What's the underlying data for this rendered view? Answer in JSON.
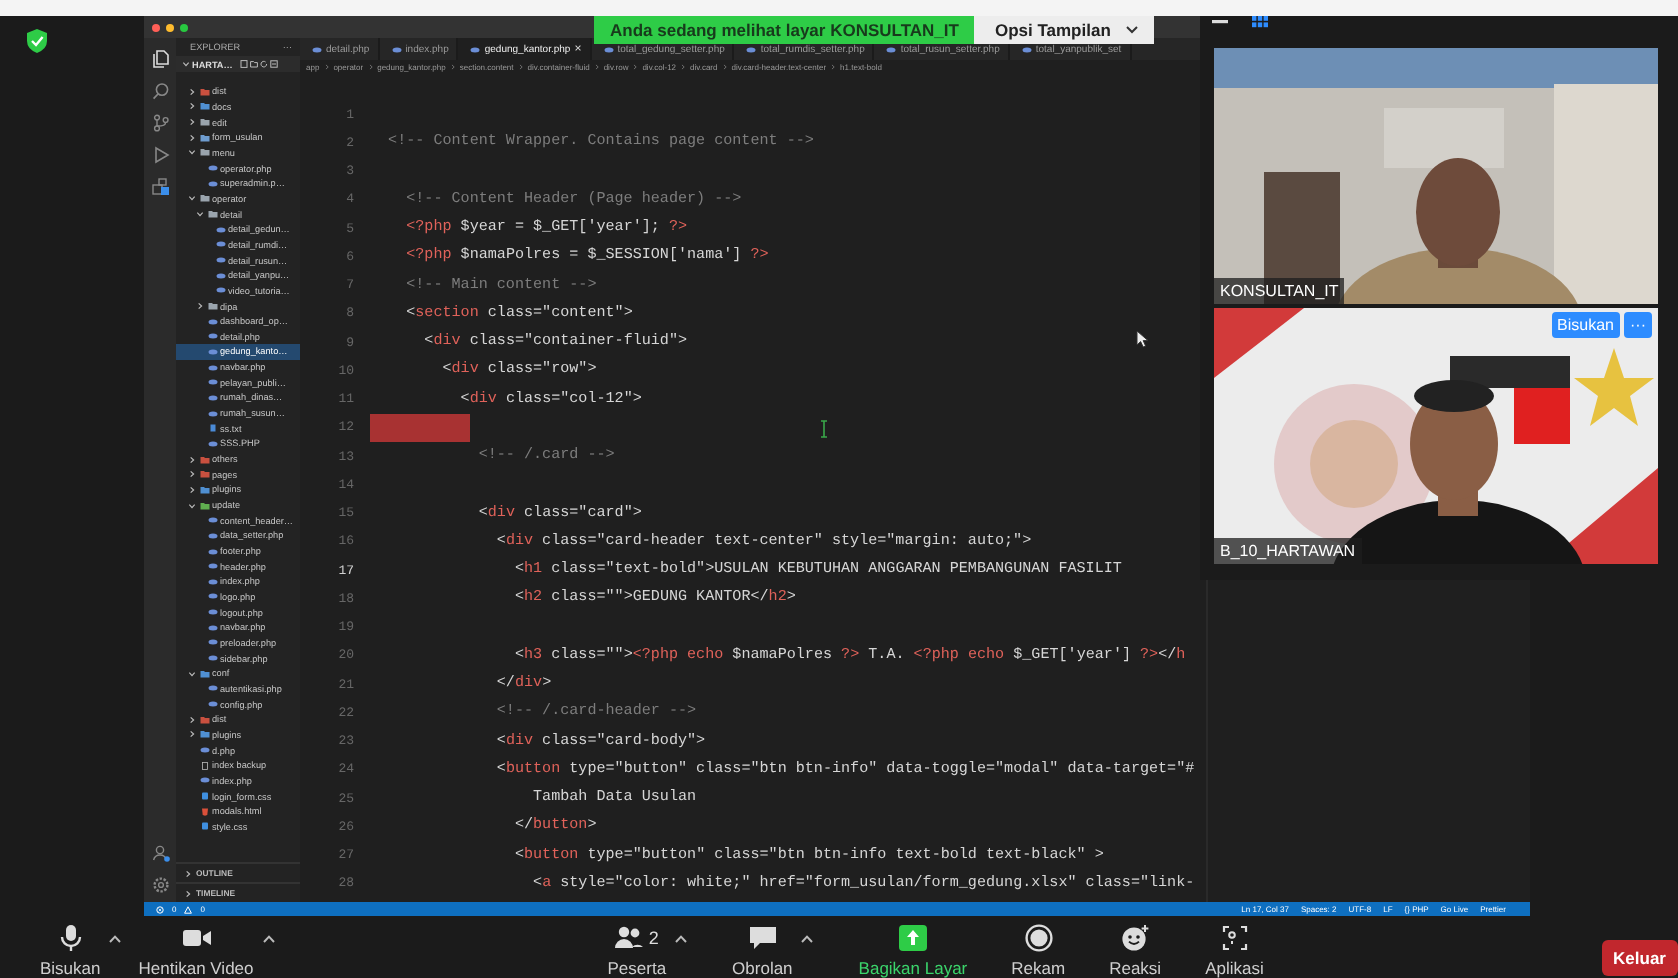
{
  "banner": {
    "text": "Anda sedang melihat layar KONSULTAN_IT",
    "options": "Opsi Tampilan"
  },
  "editor": {
    "explorer": {
      "title": "EXPLORER",
      "more": "···",
      "root": "HARTA…",
      "tree": [
        {
          "name": "dist",
          "kind": "folder",
          "color": "#c9503f",
          "expanded": false,
          "selected": false
        },
        {
          "name": "docs",
          "kind": "folder",
          "color": "#4f8fd1",
          "expanded": false,
          "selected": false
        },
        {
          "name": "edit",
          "kind": "folder",
          "color": "#9aa4ad",
          "expanded": false,
          "selected": false
        },
        {
          "name": "form_usulan",
          "kind": "folder",
          "color": "#6e9ccf",
          "expanded": false,
          "selected": false
        },
        {
          "name": "menu",
          "kind": "folder",
          "color": "#9aa4ad",
          "expanded": true,
          "selected": false,
          "children": [
            {
              "name": "operator.php",
              "kind": "php",
              "selected": false
            },
            {
              "name": "superadmin.p…",
              "kind": "php",
              "selected": false
            }
          ]
        },
        {
          "name": "operator",
          "kind": "folder",
          "color": "#9aa4ad",
          "expanded": true,
          "selected": false,
          "children": [
            {
              "name": "detail",
              "kind": "folder",
              "color": "#9aa4ad",
              "expanded": true,
              "selected": false,
              "children": [
                {
                  "name": "detail_gedun…",
                  "kind": "php",
                  "selected": false
                },
                {
                  "name": "detail_rumdi…",
                  "kind": "php",
                  "selected": false
                },
                {
                  "name": "detail_rusun…",
                  "kind": "php",
                  "selected": false
                },
                {
                  "name": "detail_yanpu…",
                  "kind": "php",
                  "selected": false
                },
                {
                  "name": "video_tutoria…",
                  "kind": "php",
                  "selected": false
                }
              ]
            },
            {
              "name": "dipa",
              "kind": "folder",
              "color": "#9aa4ad",
              "expanded": false,
              "selected": false
            },
            {
              "name": "dashboard_op…",
              "kind": "php",
              "selected": false
            },
            {
              "name": "detail.php",
              "kind": "php",
              "selected": false
            },
            {
              "name": "gedung_kanto…",
              "kind": "php",
              "selected": true
            },
            {
              "name": "navbar.php",
              "kind": "php",
              "selected": false
            },
            {
              "name": "pelayan_publi…",
              "kind": "php",
              "selected": false
            },
            {
              "name": "rumah_dinas…",
              "kind": "php",
              "selected": false
            },
            {
              "name": "rumah_susun…",
              "kind": "php",
              "selected": false
            },
            {
              "name": "ss.txt",
              "kind": "txt",
              "selected": false
            },
            {
              "name": "SSS.PHP",
              "kind": "php",
              "selected": false
            }
          ]
        },
        {
          "name": "others",
          "kind": "folder",
          "color": "#c9503f",
          "expanded": false,
          "selected": false
        },
        {
          "name": "pages",
          "kind": "folder",
          "color": "#c9503f",
          "expanded": false,
          "selected": false
        },
        {
          "name": "plugins",
          "kind": "folder",
          "color": "#4f8fd1",
          "expanded": false,
          "selected": false
        },
        {
          "name": "update",
          "kind": "folder",
          "color": "#5fae4f",
          "expanded": true,
          "selected": false,
          "children": [
            {
              "name": "content_header…",
              "kind": "php",
              "selected": false
            },
            {
              "name": "data_setter.php",
              "kind": "php",
              "selected": false
            },
            {
              "name": "footer.php",
              "kind": "php",
              "selected": false
            },
            {
              "name": "header.php",
              "kind": "php",
              "selected": false
            },
            {
              "name": "index.php",
              "kind": "php",
              "selected": false
            },
            {
              "name": "logo.php",
              "kind": "php",
              "selected": false
            },
            {
              "name": "logout.php",
              "kind": "php",
              "selected": false
            },
            {
              "name": "navbar.php",
              "kind": "php",
              "selected": false
            },
            {
              "name": "preloader.php",
              "kind": "php",
              "selected": false
            },
            {
              "name": "sidebar.php",
              "kind": "php",
              "selected": false
            }
          ]
        },
        {
          "name": "conf",
          "kind": "folder",
          "color": "#4f8fd1",
          "expanded": true,
          "selected": false,
          "children": [
            {
              "name": "autentikasi.php",
              "kind": "php",
              "selected": false
            },
            {
              "name": "config.php",
              "kind": "php",
              "selected": false
            }
          ]
        },
        {
          "name": "dist",
          "kind": "folder",
          "color": "#c9503f",
          "expanded": false,
          "selected": false
        },
        {
          "name": "plugins",
          "kind": "folder",
          "color": "#4f8fd1",
          "expanded": false,
          "selected": false
        },
        {
          "name": "d.php",
          "kind": "php",
          "selected": false
        },
        {
          "name": "index backup",
          "kind": "plain",
          "selected": false
        },
        {
          "name": "index.php",
          "kind": "php",
          "selected": false
        },
        {
          "name": "login_form.css",
          "kind": "css",
          "selected": false
        },
        {
          "name": "modals.html",
          "kind": "html",
          "selected": false
        },
        {
          "name": "style.css",
          "kind": "css",
          "selected": false
        }
      ],
      "sections": [
        "OUTLINE",
        "TIMELINE"
      ]
    },
    "tabs": [
      {
        "label": "detail.php",
        "selected": false
      },
      {
        "label": "index.php",
        "selected": false
      },
      {
        "label": "gedung_kantor.php",
        "selected": true,
        "close": "×"
      },
      {
        "label": "total_gedung_setter.php",
        "selected": false
      },
      {
        "label": "total_rumdis_setter.php",
        "selected": false
      },
      {
        "label": "total_rusun_setter.php",
        "selected": false
      },
      {
        "label": "total_yanpublik_set",
        "selected": false
      }
    ],
    "breadcrumb": [
      "app",
      "operator",
      "gedung_kantor.php",
      "section.content",
      "div.container-fluid",
      "div.row",
      "div.col-12",
      "div.card",
      "div.card-header.text-center",
      "h1.text-bold"
    ],
    "lines": [
      {
        "number": "1",
        "current": false,
        "error": false
      },
      {
        "number": "2",
        "current": false,
        "error": false,
        "tokens": [
          {
            "kind": "comment",
            "text": "  <!-- Content Wrapper. Contains page content -->"
          }
        ]
      },
      {
        "number": "3",
        "current": false,
        "error": false
      },
      {
        "number": "4",
        "current": false,
        "error": false,
        "tokens": [
          {
            "kind": "comment",
            "text": "    <!-- Content Header (Page header) -->"
          }
        ]
      },
      {
        "number": "5",
        "current": false,
        "error": false,
        "tokens": [
          {
            "kind": "tag",
            "text": "    <?php"
          },
          {
            "kind": "plain",
            "text": " $year = $_GET['year']; "
          },
          {
            "kind": "tag",
            "text": "?>"
          }
        ]
      },
      {
        "number": "6",
        "current": false,
        "error": false,
        "tokens": [
          {
            "kind": "tag",
            "text": "    <?php"
          },
          {
            "kind": "plain",
            "text": " $namaPolres = $_SESSION['nama'] "
          },
          {
            "kind": "tag",
            "text": "?>"
          }
        ]
      },
      {
        "number": "7",
        "current": false,
        "error": false,
        "tokens": [
          {
            "kind": "comment",
            "text": "    <!-- Main content -->"
          }
        ]
      },
      {
        "number": "8",
        "current": false,
        "error": false,
        "tokens": [
          {
            "kind": "plain",
            "text": "    <"
          },
          {
            "kind": "tag",
            "text": "section"
          },
          {
            "kind": "plain",
            "text": " class=\"content\">"
          }
        ]
      },
      {
        "number": "9",
        "current": false,
        "error": false,
        "tokens": [
          {
            "kind": "plain",
            "text": "      <"
          },
          {
            "kind": "tag",
            "text": "div"
          },
          {
            "kind": "plain",
            "text": " class=\"container-fluid\">"
          }
        ]
      },
      {
        "number": "10",
        "current": false,
        "error": false,
        "tokens": [
          {
            "kind": "plain",
            "text": "        <"
          },
          {
            "kind": "tag",
            "text": "div"
          },
          {
            "kind": "plain",
            "text": " class=\"row\">"
          }
        ]
      },
      {
        "number": "11",
        "current": false,
        "error": false,
        "tokens": [
          {
            "kind": "plain",
            "text": "          <"
          },
          {
            "kind": "tag",
            "text": "div"
          },
          {
            "kind": "plain",
            "text": " class=\"col-12\">"
          }
        ]
      },
      {
        "number": "12",
        "current": false,
        "error": true
      },
      {
        "number": "13",
        "current": false,
        "error": false,
        "tokens": [
          {
            "kind": "comment",
            "text": "            <!-- /.card -->"
          }
        ]
      },
      {
        "number": "14",
        "current": false,
        "error": false
      },
      {
        "number": "15",
        "current": false,
        "error": false,
        "tokens": [
          {
            "kind": "plain",
            "text": "            <"
          },
          {
            "kind": "tag",
            "text": "div"
          },
          {
            "kind": "plain",
            "text": " class=\"card\">"
          }
        ]
      },
      {
        "number": "16",
        "current": false,
        "error": false,
        "tokens": [
          {
            "kind": "plain",
            "text": "              <"
          },
          {
            "kind": "tag",
            "text": "div"
          },
          {
            "kind": "plain",
            "text": " class=\"card-header text-center\" style=\"margin: auto;\">"
          }
        ]
      },
      {
        "number": "17",
        "current": true,
        "error": false,
        "tokens": [
          {
            "kind": "plain",
            "text": "                <"
          },
          {
            "kind": "tag",
            "text": "h1"
          },
          {
            "kind": "plain",
            "text": " class=\"text-bold\">USULAN KEBUTUHAN ANGGARAN PEMBANGUNAN FASILIT"
          }
        ]
      },
      {
        "number": "18",
        "current": false,
        "error": false,
        "tokens": [
          {
            "kind": "plain",
            "text": "                <"
          },
          {
            "kind": "tag",
            "text": "h2"
          },
          {
            "kind": "plain",
            "text": " class=\"\">GEDUNG KANTOR</"
          },
          {
            "kind": "tag",
            "text": "h2"
          },
          {
            "kind": "plain",
            "text": ">"
          }
        ]
      },
      {
        "number": "19",
        "current": false,
        "error": false
      },
      {
        "number": "20",
        "current": false,
        "error": false,
        "tokens": [
          {
            "kind": "plain",
            "text": "                <"
          },
          {
            "kind": "tag",
            "text": "h3"
          },
          {
            "kind": "plain",
            "text": " class=\"\">"
          },
          {
            "kind": "tag",
            "text": "<?php echo"
          },
          {
            "kind": "plain",
            "text": " $namaPolres "
          },
          {
            "kind": "tag",
            "text": "?>"
          },
          {
            "kind": "plain",
            "text": " T.A. "
          },
          {
            "kind": "tag",
            "text": "<?php echo"
          },
          {
            "kind": "plain",
            "text": " $_GET['year'] "
          },
          {
            "kind": "tag",
            "text": "?>"
          },
          {
            "kind": "plain",
            "text": "</"
          },
          {
            "kind": "tag",
            "text": "h"
          }
        ]
      },
      {
        "number": "21",
        "current": false,
        "error": false,
        "tokens": [
          {
            "kind": "plain",
            "text": "              </"
          },
          {
            "kind": "tag",
            "text": "div"
          },
          {
            "kind": "plain",
            "text": ">"
          }
        ]
      },
      {
        "number": "22",
        "current": false,
        "error": false,
        "tokens": [
          {
            "kind": "comment",
            "text": "              <!-- /.card-header -->"
          }
        ]
      },
      {
        "number": "23",
        "current": false,
        "error": false,
        "tokens": [
          {
            "kind": "plain",
            "text": "              <"
          },
          {
            "kind": "tag",
            "text": "div"
          },
          {
            "kind": "plain",
            "text": " class=\"card-body\">"
          }
        ]
      },
      {
        "number": "24",
        "current": false,
        "error": false,
        "tokens": [
          {
            "kind": "plain",
            "text": "              <"
          },
          {
            "kind": "tag",
            "text": "button"
          },
          {
            "kind": "plain",
            "text": " type=\"button\" class=\"btn btn-info\" data-toggle=\"modal\" data-target=\"#"
          }
        ]
      },
      {
        "number": "25",
        "current": false,
        "error": false,
        "tokens": [
          {
            "kind": "plain",
            "text": "                  Tambah Data Usulan"
          }
        ]
      },
      {
        "number": "26",
        "current": false,
        "error": false,
        "tokens": [
          {
            "kind": "plain",
            "text": "                </"
          },
          {
            "kind": "tag",
            "text": "button"
          },
          {
            "kind": "plain",
            "text": ">"
          }
        ]
      },
      {
        "number": "27",
        "current": false,
        "error": false,
        "tokens": [
          {
            "kind": "plain",
            "text": "                <"
          },
          {
            "kind": "tag",
            "text": "button"
          },
          {
            "kind": "plain",
            "text": " type=\"button\" class=\"btn btn-info text-bold text-black\" >"
          }
        ]
      },
      {
        "number": "28",
        "current": false,
        "error": false,
        "tokens": [
          {
            "kind": "plain",
            "text": "                  <"
          },
          {
            "kind": "tag",
            "text": "a"
          },
          {
            "kind": "plain",
            "text": " style=\"color: white;\" href=\"form_usulan/form_gedung.xlsx\" class=\"link-"
          }
        ]
      }
    ],
    "status_bar": {
      "errors": "0",
      "warnings": "0",
      "items": [
        "Ln 17, Col 37",
        "Spaces: 2",
        "UTF-8",
        "LF",
        "{} PHP",
        "Go Live",
        "Prettier"
      ]
    }
  },
  "participants": [
    {
      "name": "KONSULTAN_IT"
    },
    {
      "name": "B_10_HARTAWAN",
      "buttons": [
        "Bisukan",
        "···"
      ]
    }
  ],
  "toolbar": [
    {
      "kind": "mic",
      "label": "Bisukan",
      "caret": true
    },
    {
      "kind": "camera",
      "label": "Hentikan Video",
      "caret": true
    },
    {
      "kind": "participants",
      "label": "Peserta",
      "count": "2",
      "caret": true
    },
    {
      "kind": "chat",
      "label": "Obrolan",
      "caret": true
    },
    {
      "kind": "share",
      "label": "Bagikan Layar",
      "caret": false
    },
    {
      "kind": "record",
      "label": "Rekam",
      "caret": false
    },
    {
      "kind": "reactions",
      "label": "Reaksi",
      "caret": false
    },
    {
      "kind": "apps",
      "label": "Aplikasi",
      "caret": false
    }
  ],
  "leave_button": "Keluar"
}
